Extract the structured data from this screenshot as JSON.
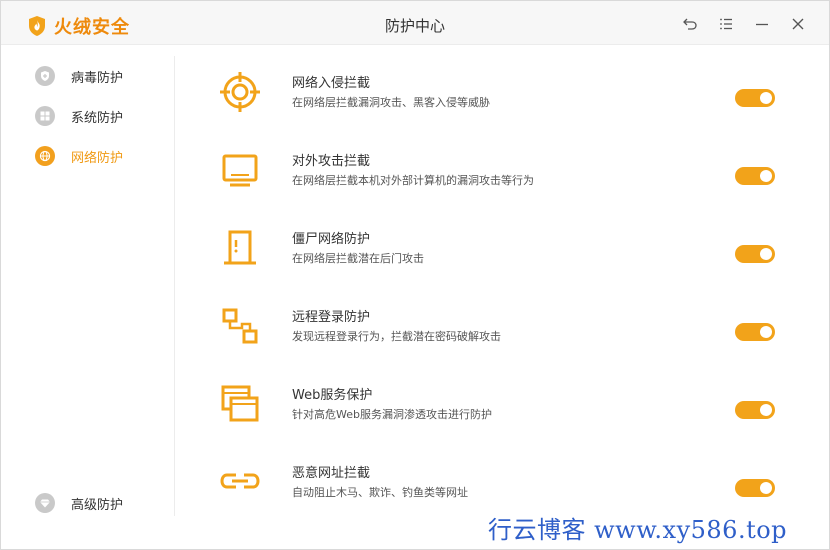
{
  "app": {
    "brand": "火绒安全",
    "window_title": "防护中心",
    "accent_color": "#f2a31a"
  },
  "titlebar_buttons": [
    {
      "name": "back-icon"
    },
    {
      "name": "menu-icon"
    },
    {
      "name": "minimize-icon"
    },
    {
      "name": "close-icon"
    }
  ],
  "sidebar": {
    "items": [
      {
        "label": "病毒防护",
        "icon": "virus-shield-icon",
        "active": false
      },
      {
        "label": "系统防护",
        "icon": "windows-icon",
        "active": false
      },
      {
        "label": "网络防护",
        "icon": "globe-icon",
        "active": true
      }
    ],
    "bottom_item": {
      "label": "高级防护",
      "icon": "diamond-icon",
      "active": false
    }
  },
  "protections": [
    {
      "title": "网络入侵拦截",
      "desc": "在网络层拦截漏洞攻击、黑客入侵等威胁",
      "icon": "target-icon",
      "enabled": true
    },
    {
      "title": "对外攻击拦截",
      "desc": "在网络层拦截本机对外部计算机的漏洞攻击等行为",
      "icon": "monitor-icon",
      "enabled": true
    },
    {
      "title": "僵尸网络防护",
      "desc": "在网络层拦截潜在后门攻击",
      "icon": "door-icon",
      "enabled": true
    },
    {
      "title": "远程登录防护",
      "desc": "发现远程登录行为，拦截潜在密码破解攻击",
      "icon": "remote-connection-icon",
      "enabled": true
    },
    {
      "title": "Web服务保护",
      "desc": "针对高危Web服务漏洞渗透攻击进行防护",
      "icon": "browser-windows-icon",
      "enabled": true
    },
    {
      "title": "恶意网址拦截",
      "desc": "自动阻止木马、欺诈、钓鱼类等网址",
      "icon": "link-icon",
      "enabled": true
    }
  ],
  "watermark": "行云博客 www.xy586.top"
}
